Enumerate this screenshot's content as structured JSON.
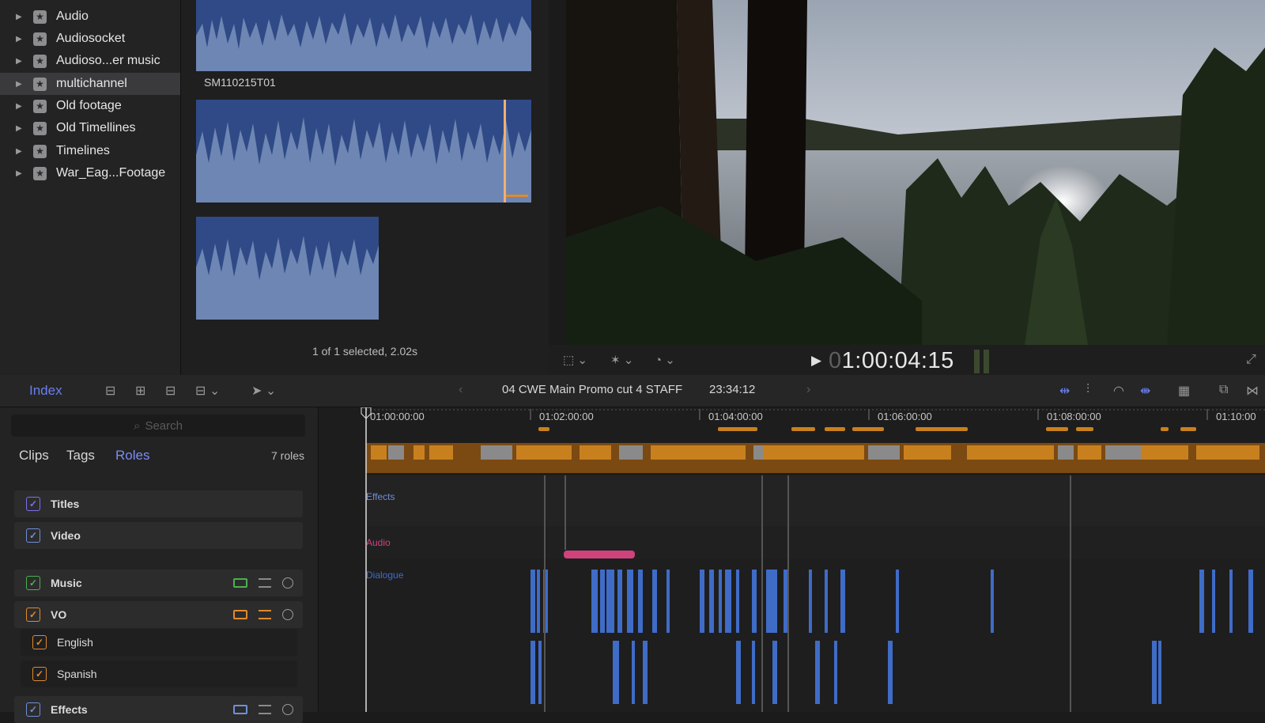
{
  "library": {
    "items": [
      {
        "label": "Audio",
        "selected": false
      },
      {
        "label": "Audiosocket",
        "selected": false
      },
      {
        "label": "Audioso...er music",
        "selected": false
      },
      {
        "label": "multichannel",
        "selected": true
      },
      {
        "label": "Old footage",
        "selected": false
      },
      {
        "label": "Old Timellines",
        "selected": false
      },
      {
        "label": "Timelines",
        "selected": false
      },
      {
        "label": "War_Eag...Footage",
        "selected": false
      }
    ]
  },
  "browser": {
    "clip_name": "SM110215T01",
    "selection_info": "1 of 1 selected, 2.02s"
  },
  "viewer": {
    "timecode_dim": "0",
    "timecode": "1:00:04:15"
  },
  "toolbar": {
    "index_label": "Index",
    "project_name": "04 CWE Main Promo cut 4 STAFF",
    "project_duration": "23:34:12"
  },
  "index": {
    "search_placeholder": "Search",
    "tabs": [
      "Clips",
      "Tags",
      "Roles"
    ],
    "active_tab": "Roles",
    "roles_count": "7 roles",
    "roles": [
      {
        "label": "Titles",
        "color": "#7c6ef0",
        "checked": true
      },
      {
        "label": "Video",
        "color": "#6f8fd8",
        "checked": true
      },
      {
        "label": "Music",
        "color": "#4caf50",
        "checked": true
      },
      {
        "label": "VO",
        "color": "#e08a2c",
        "checked": true
      },
      {
        "label": "English",
        "color": "#e08a2c",
        "checked": true
      },
      {
        "label": "Spanish",
        "color": "#e08a2c",
        "checked": true
      },
      {
        "label": "Effects",
        "color": "#6f8fd8",
        "checked": true
      }
    ]
  },
  "timeline": {
    "ruler": [
      "01:00:00:00",
      "01:02:00:00",
      "01:04:00:00",
      "01:06:00:00",
      "01:08:00:00",
      "01:10:00"
    ],
    "lanes": {
      "effects": "Effects",
      "audio": "Audio",
      "dialogue": "Dialogue"
    },
    "colors": {
      "storyline": "#c8801f",
      "dialogue": "#3f6cc7",
      "audio": "#d0427c",
      "accent": "#6a7ff0"
    }
  }
}
